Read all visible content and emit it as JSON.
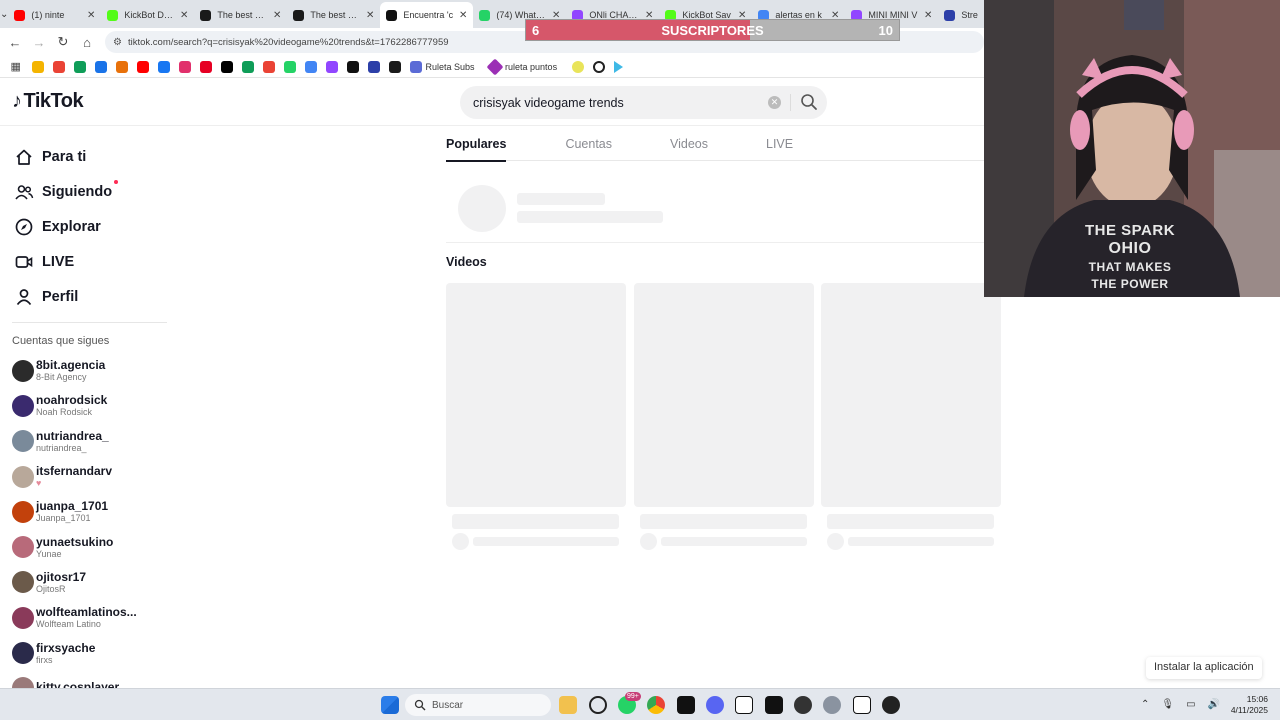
{
  "browser": {
    "tabs": [
      {
        "title": "(1) ninte",
        "fav": "#ff0000",
        "active": false
      },
      {
        "title": "KickBot Dash",
        "fav": "#53fc18",
        "active": false
      },
      {
        "title": "The best Cha",
        "fav": "#1a1a1a",
        "active": false
      },
      {
        "title": "The best Cha",
        "fav": "#1a1a1a",
        "active": false
      },
      {
        "title": "Encuentra 'c",
        "fav": "#111111",
        "active": true
      },
      {
        "title": "(74) WhatsAp",
        "fav": "#25d366",
        "active": false
      },
      {
        "title": "ONli CHANN",
        "fav": "#9146ff",
        "active": false
      },
      {
        "title": "KickBot Sav",
        "fav": "#53fc18",
        "active": false
      },
      {
        "title": "alertas en k",
        "fav": "#4285f4",
        "active": false
      },
      {
        "title": "MINI MINI V",
        "fav": "#9146ff",
        "active": false
      },
      {
        "title": "Stre",
        "fav": "#2c3fa8",
        "active": false
      }
    ],
    "url": "tiktok.com/search?q=crisisyak%20videogame%20trends&t=1762286777959",
    "bookmarks": [
      {
        "label": "Ruleta Subs",
        "color": "#5b6bd6"
      },
      {
        "label": "ruleta puntos",
        "color": "#9b2fb5"
      }
    ],
    "bookmark_icon_colors": [
      "#f4b400",
      "#ea4335",
      "#0f9d58",
      "#1a73e8",
      "#e8710a",
      "#ff0000",
      "#1877f2",
      "#e1306c",
      "#e60023",
      "#000000",
      "#0f9d58",
      "#ea4335",
      "#25d366",
      "#4285f4",
      "#9146ff",
      "#111111",
      "#2c3fa8",
      "#1a1a1a"
    ]
  },
  "overlay": {
    "left": "6",
    "label": "SUSCRIPTORES",
    "right": "10",
    "progress": 0.6,
    "fill_color": "#d6576a"
  },
  "tiktok": {
    "logo": "TikTok",
    "search_value": "crisisyak videogame trends",
    "nav": [
      {
        "label": "Para ti",
        "icon": "home-icon"
      },
      {
        "label": "Siguiendo",
        "icon": "following-icon",
        "dot": true
      },
      {
        "label": "Explorar",
        "icon": "compass-icon"
      },
      {
        "label": "LIVE",
        "icon": "live-icon"
      },
      {
        "label": "Perfil",
        "icon": "profile-icon"
      }
    ],
    "following_header": "Cuentas que sigues",
    "accounts": [
      {
        "user": "8bit.agencia",
        "name": "8-Bit Agency",
        "color": "#2b2b2b"
      },
      {
        "user": "noahrodsick",
        "name": "Noah Rodsick",
        "color": "#3a2a6e"
      },
      {
        "user": "nutriandrea_",
        "name": "nutriandrea_",
        "color": "#7a8a9a"
      },
      {
        "user": "itsfernandarv",
        "name": "♥",
        "color": "#b8a89a"
      },
      {
        "user": "juanpa_1701",
        "name": "Juanpa_1701",
        "color": "#c2410c"
      },
      {
        "user": "yunaetsukino",
        "name": "Yunae",
        "color": "#b86a7a"
      },
      {
        "user": "ojitosr17",
        "name": "OjitosR",
        "color": "#6b5a4a"
      },
      {
        "user": "wolfteamlatinos...",
        "name": "Wolfteam Latino",
        "color": "#8a3a5a"
      },
      {
        "user": "firxsyache",
        "name": "firxs",
        "color": "#2a2a4a"
      },
      {
        "user": "kitty.cosplayer",
        "name": "",
        "color": "#9a7a7a"
      }
    ],
    "search_tabs": [
      "Populares",
      "Cuentas",
      "Videos",
      "LIVE"
    ],
    "videos_heading": "Videos",
    "install_button": "Instalar la aplicación"
  },
  "webcam": {
    "shirt_lines": [
      "THE SPARK",
      "OHIO",
      "THAT MAKES",
      "THE POWER"
    ]
  },
  "taskbar": {
    "search_placeholder": "Buscar",
    "badge": "99+",
    "time": "15:06",
    "date": "4/11/2025"
  }
}
